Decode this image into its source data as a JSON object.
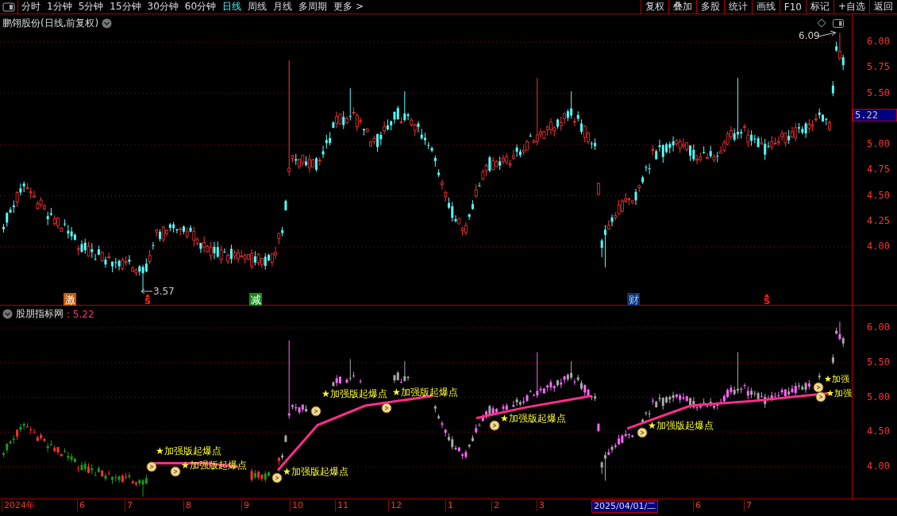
{
  "toolbar": {
    "periods": [
      {
        "label": "分时",
        "selected": false
      },
      {
        "label": "1分钟",
        "selected": false
      },
      {
        "label": "5分钟",
        "selected": false
      },
      {
        "label": "15分钟",
        "selected": false
      },
      {
        "label": "30分钟",
        "selected": false
      },
      {
        "label": "60分钟",
        "selected": false
      },
      {
        "label": "日线",
        "selected": true
      },
      {
        "label": "周线",
        "selected": false
      },
      {
        "label": "月线",
        "selected": false
      },
      {
        "label": "多周期",
        "selected": false
      },
      {
        "label": "更多 >",
        "selected": false
      }
    ],
    "actions": [
      "复权",
      "叠加",
      "多股",
      "统计",
      "画线",
      "F10",
      "标记",
      "+自选",
      "返回"
    ]
  },
  "main_chart": {
    "title": "鹏翎股份(日线,前复权)",
    "y_ticks": [
      "6.00",
      "5.75",
      "5.50",
      "5.00",
      "4.75",
      "4.50",
      "4.25",
      "4.00"
    ],
    "current_price": "5.22",
    "high_label": "6.09",
    "low_label": "3.57",
    "markers": [
      {
        "kind": "badge",
        "text": "激",
        "color": "#c85a00"
      },
      {
        "kind": "arrow",
        "text": "S",
        "color": "#ff2020"
      },
      {
        "kind": "badge",
        "text": "减",
        "color": "#1a8a1a"
      },
      {
        "kind": "badge",
        "text": "财",
        "color": "#103070"
      },
      {
        "kind": "arrow",
        "text": "S",
        "color": "#ff2020"
      }
    ]
  },
  "indicator": {
    "name": "股朋指标网",
    "value": ": 5.22",
    "y_ticks": [
      "6.00",
      "5.50",
      "5.00",
      "4.50",
      "4.00"
    ],
    "signals": [
      "★加强版起爆点",
      "★加强版起爆点",
      "★加强版起爆点",
      "★加强版起爆点",
      "★加强版起爆点",
      "★加强版起爆点",
      "★加强版起爆点",
      "★加强",
      "★加强"
    ]
  },
  "date_axis": [
    {
      "label": "2024年",
      "selected": false
    },
    {
      "label": "6",
      "selected": false
    },
    {
      "label": "7",
      "selected": false
    },
    {
      "label": "8",
      "selected": false
    },
    {
      "label": "9",
      "selected": false
    },
    {
      "label": "10",
      "selected": false
    },
    {
      "label": "11",
      "selected": false
    },
    {
      "label": "12",
      "selected": false
    },
    {
      "label": "1",
      "selected": false
    },
    {
      "label": "2",
      "selected": false
    },
    {
      "label": "3",
      "selected": false
    },
    {
      "label": "2025/04/01/二",
      "selected": true
    },
    {
      "label": "6",
      "selected": false
    },
    {
      "label": "7",
      "selected": false
    }
  ]
}
